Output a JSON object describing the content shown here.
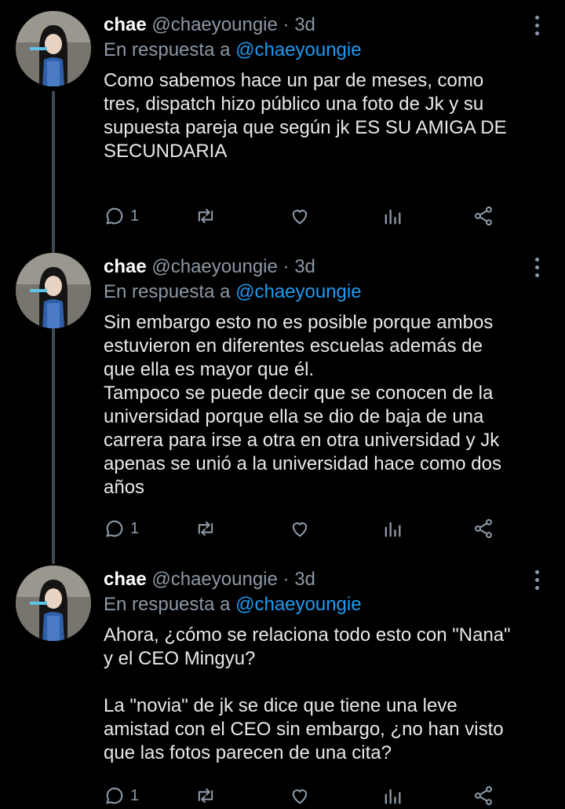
{
  "tweets": [
    {
      "name": "chae",
      "handle": "@chaeyoungie",
      "time": "· 3d",
      "reply_prefix": "En respuesta a",
      "reply_to": "@chaeyoungie",
      "text": "Como sabemos hace un par de meses, como\ntres, dispatch hizo público una foto de Jk y su\nsupuesta pareja que según jk ES SU AMIGA DE\nSECUNDARIA",
      "reply_count": "1"
    },
    {
      "name": "chae",
      "handle": "@chaeyoungie",
      "time": "· 3d",
      "reply_prefix": "En respuesta a",
      "reply_to": "@chaeyoungie",
      "text": "Sin embargo esto no es posible porque ambos\nestuvieron en diferentes escuelas además de\nque ella es mayor que él.\nTampoco se puede decir que se conocen de la\nuniversidad porque ella se dio de baja de una\ncarrera para irse a otra en otra universidad y Jk\napenas se unió a la universidad hace como dos\naños",
      "reply_count": "1"
    },
    {
      "name": "chae",
      "handle": "@chaeyoungie",
      "time": "· 3d",
      "reply_prefix": "En respuesta a",
      "reply_to": "@chaeyoungie",
      "text": "Ahora, ¿cómo se relaciona todo esto con \"Nana\"\ny el CEO Mingyu?\n\nLa \"novia\" de jk se dice que tiene una leve\namistad con el CEO sin embargo, ¿no han visto\nque las fotos parecen de una cita?",
      "reply_count": "1"
    }
  ],
  "icons": [
    "reply-icon",
    "retweet-icon",
    "like-icon",
    "analytics-icon",
    "share-icon",
    "more-icon"
  ],
  "colors": {
    "background": "#000000",
    "text": "#e7e9ea",
    "secondary": "#8b98a5",
    "link": "#1d9bf0",
    "thread": "#3d4a56"
  }
}
